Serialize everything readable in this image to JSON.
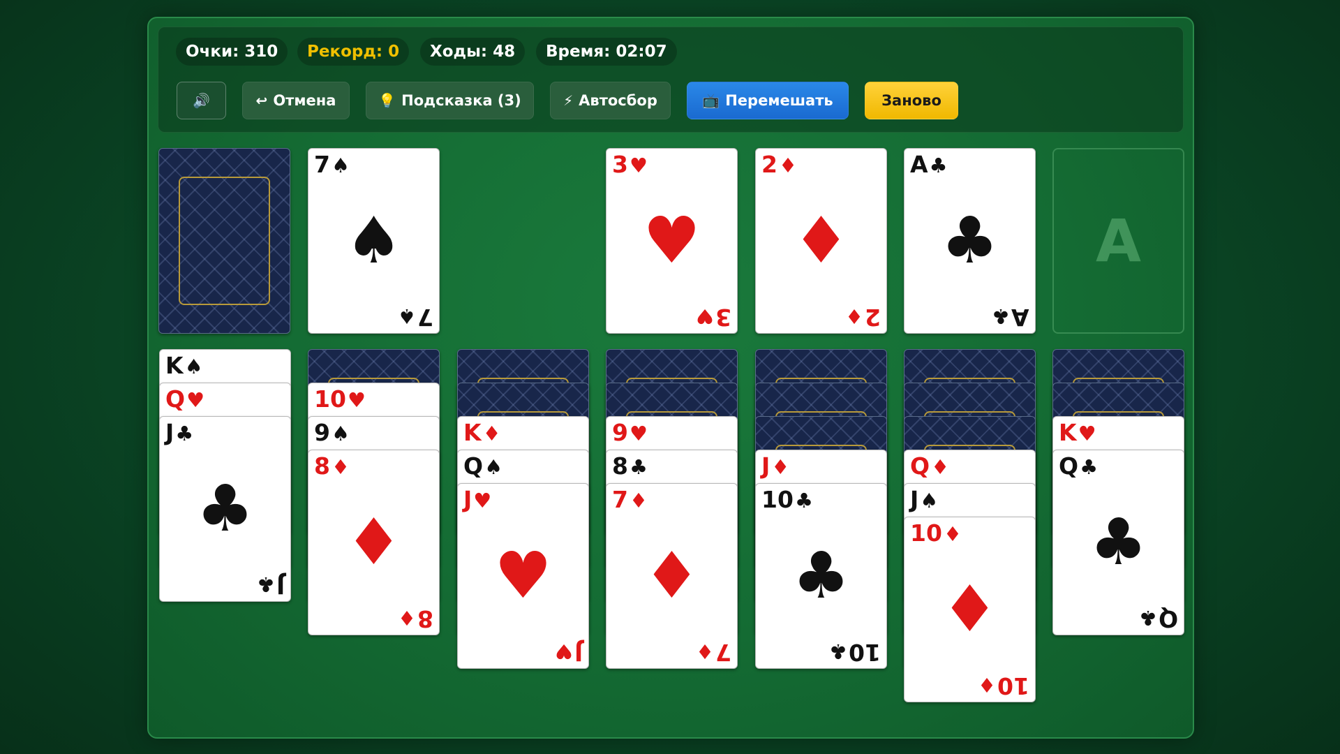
{
  "stats": {
    "score": "Очки: 310",
    "record": "Рекорд: 0",
    "moves": "Ходы: 48",
    "time": "Время: 02:07"
  },
  "toolbar": {
    "sound_icon": "🔊",
    "undo_icon": "↩",
    "undo_label": "Отмена",
    "hint_icon": "💡",
    "hint_label": "Подсказка (3)",
    "auto_icon": "⚡",
    "auto_label": "Автосбор",
    "shuffle_icon": "📺",
    "shuffle_label": "Перемешать",
    "restart_label": "Заново"
  },
  "suit_symbols": {
    "spade": "♠",
    "heart": "♥",
    "diamond": "♦",
    "club": "♣"
  },
  "colors": {
    "red": "#e01818",
    "black": "#111111",
    "felt": "#146b33",
    "blue_button": "#2a88e8",
    "gold_button": "#ffd23a",
    "record_text": "#f0c000"
  },
  "waste": {
    "rank": "7",
    "suit": "♠"
  },
  "foundations": [
    {
      "rank": "3",
      "suit": "♥"
    },
    {
      "rank": "2",
      "suit": "♦"
    },
    {
      "rank": "A",
      "suit": "♣"
    },
    {
      "empty_label": "A"
    }
  ],
  "tableau": [
    {
      "hidden": 0,
      "cards": [
        {
          "rank": "K",
          "suit": "♠"
        },
        {
          "rank": "Q",
          "suit": "♥"
        },
        {
          "rank": "J",
          "suit": "♣"
        }
      ]
    },
    {
      "hidden": 1,
      "cards": [
        {
          "rank": "10",
          "suit": "♥"
        },
        {
          "rank": "9",
          "suit": "♠"
        },
        {
          "rank": "8",
          "suit": "♦"
        }
      ]
    },
    {
      "hidden": 2,
      "cards": [
        {
          "rank": "K",
          "suit": "♦"
        },
        {
          "rank": "Q",
          "suit": "♠"
        },
        {
          "rank": "J",
          "suit": "♥"
        }
      ]
    },
    {
      "hidden": 2,
      "cards": [
        {
          "rank": "9",
          "suit": "♥"
        },
        {
          "rank": "8",
          "suit": "♣"
        },
        {
          "rank": "7",
          "suit": "♦"
        }
      ]
    },
    {
      "hidden": 3,
      "cards": [
        {
          "rank": "J",
          "suit": "♦"
        },
        {
          "rank": "10",
          "suit": "♣"
        }
      ]
    },
    {
      "hidden": 3,
      "cards": [
        {
          "rank": "Q",
          "suit": "♦"
        },
        {
          "rank": "J",
          "suit": "♠"
        },
        {
          "rank": "10",
          "suit": "♦"
        }
      ]
    },
    {
      "hidden": 2,
      "cards": [
        {
          "rank": "K",
          "suit": "♥"
        },
        {
          "rank": "Q",
          "suit": "♣"
        }
      ]
    }
  ]
}
